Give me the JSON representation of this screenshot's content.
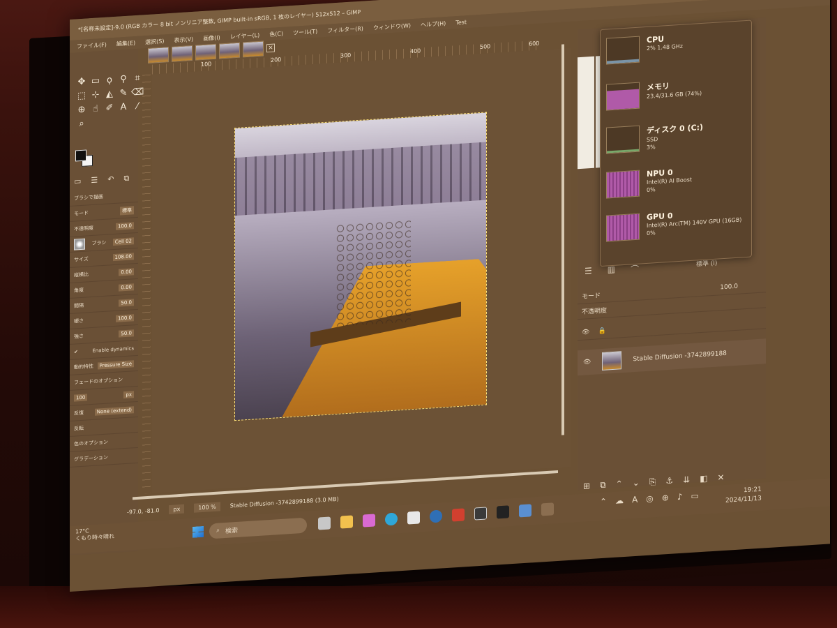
{
  "window": {
    "title": "*[名称未設定]-9.0 (RGB カラー 8 bit ノンリニア整数, GIMP built-in sRGB, 1 枚のレイヤー) 512x512 – GIMP",
    "controls": [
      "—",
      "❐",
      "✕"
    ]
  },
  "menu": [
    "ファイル(F)",
    "編集(E)",
    "選択(S)",
    "表示(V)",
    "画像(I)",
    "レイヤー(L)",
    "色(C)",
    "ツール(T)",
    "フィルター(R)",
    "ウィンドウ(W)",
    "ヘルプ(H)",
    "Test"
  ],
  "ruler": {
    "ticks": [
      "100",
      "200",
      "300",
      "400",
      "500",
      "600"
    ]
  },
  "tool_options": {
    "title": "ブラシで描画",
    "mode_label": "モード",
    "mode_value": "標準",
    "opacity_label": "不透明度",
    "opacity_value": "100.0",
    "brush_label": "ブラシ",
    "brush_value": "Cell 02",
    "rows": [
      {
        "label": "サイズ",
        "value": "108.00"
      },
      {
        "label": "縦横比",
        "value": "0.00"
      },
      {
        "label": "角度",
        "value": "0.00"
      },
      {
        "label": "間隔",
        "value": "50.0"
      },
      {
        "label": "硬さ",
        "value": "100.0"
      },
      {
        "label": "強さ",
        "value": "50.0"
      }
    ],
    "enable_dynamics": "Enable dynamics",
    "dynamics_label": "動的特性",
    "dynamics_value": "Pressure Size",
    "fade_label": "フェードのオプション",
    "fade_value": "100",
    "fade_unit": "px",
    "repeat_label": "反復",
    "repeat_value": "None (extend)",
    "reverse_label": "反転",
    "color_options": "色のオプション",
    "gradient_label": "グラデーション"
  },
  "status": {
    "coords": "-97.0, -81.0",
    "unit": "px",
    "zoom": "100 %",
    "info": "Stable Diffusion -3742899188 (3.0 MB)"
  },
  "layers": {
    "mode_value": "標準 (l)",
    "mode_label": "モード",
    "opacity_label": "不透明度",
    "opacity_value": "100.0",
    "layer_name": "Stable Diffusion -3742899188"
  },
  "perf": [
    {
      "name": "CPU",
      "sub1": "2% 1.48 GHz",
      "sub2": "",
      "fill": 0.1,
      "kind": "cpu"
    },
    {
      "name": "メモリ",
      "sub1": "23.4/31.6 GB (74%)",
      "sub2": "",
      "fill": 0.74,
      "kind": "mem"
    },
    {
      "name": "ディスク 0 (C:)",
      "sub1": "SSD",
      "sub2": "3%",
      "fill": 0.03,
      "kind": "disk"
    },
    {
      "name": "NPU 0",
      "sub1": "Intel(R) AI Boost",
      "sub2": "0%",
      "fill": 1.0,
      "kind": "npu"
    },
    {
      "name": "GPU 0",
      "sub1": "Intel(R) Arc(TM) 140V GPU (16GB)",
      "sub2": "0%",
      "fill": 1.0,
      "kind": "gpu"
    }
  ],
  "taskbar": {
    "weather_temp": "17°C",
    "weather_desc": "くもり時々晴れ",
    "search": "検索",
    "time": "19:21",
    "date": "2024/11/13"
  }
}
